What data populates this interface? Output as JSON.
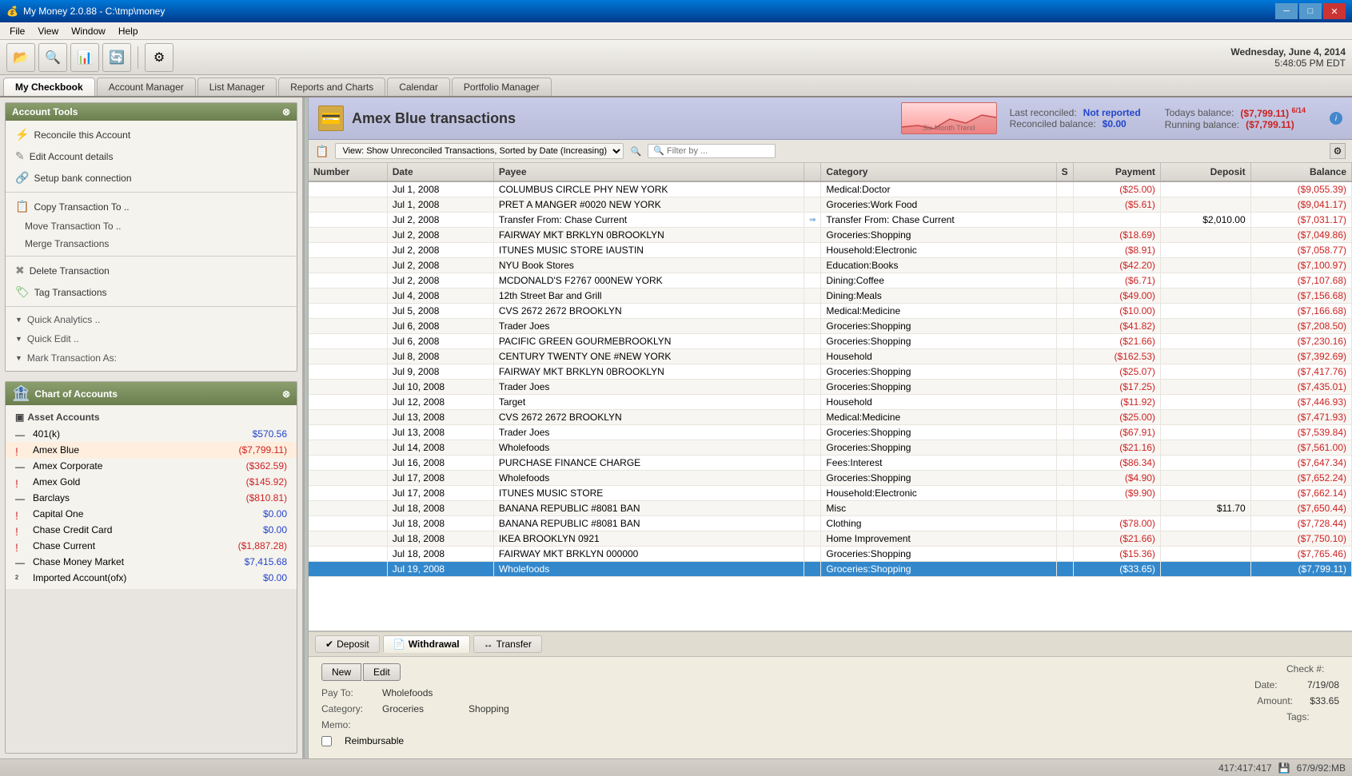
{
  "titleBar": {
    "title": "My Money 2.0.88 - C:\\tmp\\money",
    "icon": "💰",
    "buttons": [
      "minimize",
      "maximize",
      "close"
    ]
  },
  "menuBar": {
    "items": [
      "File",
      "View",
      "Window",
      "Help"
    ]
  },
  "toolbar": {
    "buttons": [
      "folder-open",
      "search",
      "chart",
      "sync",
      "settings"
    ]
  },
  "tabs": [
    {
      "label": "My Checkbook",
      "active": true
    },
    {
      "label": "Account Manager",
      "active": false
    },
    {
      "label": "List Manager",
      "active": false
    },
    {
      "label": "Reports and Charts",
      "active": false
    },
    {
      "label": "Calendar",
      "active": false
    },
    {
      "label": "Portfolio Manager",
      "active": false
    }
  ],
  "accountHeader": {
    "icon": "💳",
    "title": "Amex Blue transactions",
    "lastReconciled": "Not reported",
    "todaysBalance": "($7,799.11)",
    "reconciledBalance": "$0.00",
    "runningBalance": "($7,799.11)",
    "date": "6/14",
    "chartLabel": "Six Month Trend"
  },
  "filterBar": {
    "viewText": "View: Show Unreconciled Transactions, Sorted by Date (Increasing)",
    "filterPlaceholder": "🔍 Filter by ..."
  },
  "tableHeaders": [
    "Number",
    "Date",
    "Payee",
    "",
    "Category",
    "S",
    "Payment",
    "Deposit",
    "Balance"
  ],
  "transactions": [
    {
      "num": "",
      "date": "Jul 1, 2008",
      "payee": "COLUMBUS CIRCLE PHY NEW YORK",
      "arrow": "",
      "category": "Medical:Doctor",
      "s": "",
      "payment": "($25.00)",
      "deposit": "",
      "balance": "($9,055.39)",
      "alt": false
    },
    {
      "num": "",
      "date": "Jul 1, 2008",
      "payee": "PRET A MANGER #0020 NEW YORK",
      "arrow": "",
      "category": "Groceries:Work Food",
      "s": "",
      "payment": "($5.61)",
      "deposit": "",
      "balance": "($9,041.17)",
      "alt": true
    },
    {
      "num": "",
      "date": "Jul 2, 2008",
      "payee": "Transfer From: Chase Current",
      "arrow": "⇒",
      "category": "Transfer From: Chase Current",
      "s": "",
      "payment": "",
      "deposit": "$2,010.00",
      "balance": "($7,031.17)",
      "alt": false
    },
    {
      "num": "",
      "date": "Jul 2, 2008",
      "payee": "FAIRWAY MKT BRKLYN 0BROOKLYN",
      "arrow": "",
      "category": "Groceries:Shopping",
      "s": "",
      "payment": "($18.69)",
      "deposit": "",
      "balance": "($7,049.86)",
      "alt": true
    },
    {
      "num": "",
      "date": "Jul 2, 2008",
      "payee": "ITUNES MUSIC STORE IAUSTIN",
      "arrow": "",
      "category": "Household:Electronic",
      "s": "",
      "payment": "($8.91)",
      "deposit": "",
      "balance": "($7,058.77)",
      "alt": false
    },
    {
      "num": "",
      "date": "Jul 2, 2008",
      "payee": "NYU Book Stores",
      "arrow": "",
      "category": "Education:Books",
      "s": "",
      "payment": "($42.20)",
      "deposit": "",
      "balance": "($7,100.97)",
      "alt": true
    },
    {
      "num": "",
      "date": "Jul 2, 2008",
      "payee": "MCDONALD'S F2767 000NEW YORK",
      "arrow": "",
      "category": "Dining:Coffee",
      "s": "",
      "payment": "($6.71)",
      "deposit": "",
      "balance": "($7,107.68)",
      "alt": false
    },
    {
      "num": "",
      "date": "Jul 4, 2008",
      "payee": "12th Street Bar and Grill",
      "arrow": "",
      "category": "Dining:Meals",
      "s": "",
      "payment": "($49.00)",
      "deposit": "",
      "balance": "($7,156.68)",
      "alt": true
    },
    {
      "num": "",
      "date": "Jul 5, 2008",
      "payee": "CVS 2672 2672    BROOKLYN",
      "arrow": "",
      "category": "Medical:Medicine",
      "s": "",
      "payment": "($10.00)",
      "deposit": "",
      "balance": "($7,166.68)",
      "alt": false
    },
    {
      "num": "",
      "date": "Jul 6, 2008",
      "payee": "Trader Joes",
      "arrow": "",
      "category": "Groceries:Shopping",
      "s": "",
      "payment": "($41.82)",
      "deposit": "",
      "balance": "($7,208.50)",
      "alt": true
    },
    {
      "num": "",
      "date": "Jul 6, 2008",
      "payee": "PACIFIC GREEN GOURMEBROOKLYN",
      "arrow": "",
      "category": "Groceries:Shopping",
      "s": "",
      "payment": "($21.66)",
      "deposit": "",
      "balance": "($7,230.16)",
      "alt": false
    },
    {
      "num": "",
      "date": "Jul 8, 2008",
      "payee": "CENTURY TWENTY ONE #NEW YORK",
      "arrow": "",
      "category": "Household",
      "s": "",
      "payment": "($162.53)",
      "deposit": "",
      "balance": "($7,392.69)",
      "alt": true
    },
    {
      "num": "",
      "date": "Jul 9, 2008",
      "payee": "FAIRWAY MKT BRKLYN 0BROOKLYN",
      "arrow": "",
      "category": "Groceries:Shopping",
      "s": "",
      "payment": "($25.07)",
      "deposit": "",
      "balance": "($7,417.76)",
      "alt": false
    },
    {
      "num": "",
      "date": "Jul 10, 2008",
      "payee": "Trader Joes",
      "arrow": "",
      "category": "Groceries:Shopping",
      "s": "",
      "payment": "($17.25)",
      "deposit": "",
      "balance": "($7,435.01)",
      "alt": true
    },
    {
      "num": "",
      "date": "Jul 12, 2008",
      "payee": "Target",
      "arrow": "",
      "category": "Household",
      "s": "",
      "payment": "($11.92)",
      "deposit": "",
      "balance": "($7,446.93)",
      "alt": false
    },
    {
      "num": "",
      "date": "Jul 13, 2008",
      "payee": "CVS 2672 2672    BROOKLYN",
      "arrow": "",
      "category": "Medical:Medicine",
      "s": "",
      "payment": "($25.00)",
      "deposit": "",
      "balance": "($7,471.93)",
      "alt": true
    },
    {
      "num": "",
      "date": "Jul 13, 2008",
      "payee": "Trader Joes",
      "arrow": "",
      "category": "Groceries:Shopping",
      "s": "",
      "payment": "($67.91)",
      "deposit": "",
      "balance": "($7,539.84)",
      "alt": false
    },
    {
      "num": "",
      "date": "Jul 14, 2008",
      "payee": "Wholefoods",
      "arrow": "",
      "category": "Groceries:Shopping",
      "s": "",
      "payment": "($21.16)",
      "deposit": "",
      "balance": "($7,561.00)",
      "alt": true
    },
    {
      "num": "",
      "date": "Jul 16, 2008",
      "payee": "PURCHASE FINANCE CHARGE",
      "arrow": "",
      "category": "Fees:Interest",
      "s": "",
      "payment": "($86.34)",
      "deposit": "",
      "balance": "($7,647.34)",
      "alt": false
    },
    {
      "num": "",
      "date": "Jul 17, 2008",
      "payee": "Wholefoods",
      "arrow": "",
      "category": "Groceries:Shopping",
      "s": "",
      "payment": "($4.90)",
      "deposit": "",
      "balance": "($7,652.24)",
      "alt": true
    },
    {
      "num": "",
      "date": "Jul 17, 2008",
      "payee": "ITUNES MUSIC STORE",
      "arrow": "",
      "category": "Household:Electronic",
      "s": "",
      "payment": "($9.90)",
      "deposit": "",
      "balance": "($7,662.14)",
      "alt": false
    },
    {
      "num": "",
      "date": "Jul 18, 2008",
      "payee": "BANANA REPUBLIC #8081 BAN",
      "arrow": "",
      "category": "Misc",
      "s": "",
      "payment": "",
      "deposit": "$11.70",
      "balance": "($7,650.44)",
      "alt": true
    },
    {
      "num": "",
      "date": "Jul 18, 2008",
      "payee": "BANANA REPUBLIC #8081 BAN",
      "arrow": "",
      "category": "Clothing",
      "s": "",
      "payment": "($78.00)",
      "deposit": "",
      "balance": "($7,728.44)",
      "alt": false
    },
    {
      "num": "",
      "date": "Jul 18, 2008",
      "payee": "IKEA BROOKLYN 0921",
      "arrow": "",
      "category": "Home Improvement",
      "s": "",
      "payment": "($21.66)",
      "deposit": "",
      "balance": "($7,750.10)",
      "alt": true
    },
    {
      "num": "",
      "date": "Jul 18, 2008",
      "payee": "FAIRWAY MKT BRKLYN 000000",
      "arrow": "",
      "category": "Groceries:Shopping",
      "s": "",
      "payment": "($15.36)",
      "deposit": "",
      "balance": "($7,765.46)",
      "alt": false
    },
    {
      "num": "",
      "date": "Jul 19, 2008",
      "payee": "Wholefoods",
      "arrow": "",
      "category": "Groceries:Shopping",
      "s": "",
      "payment": "($33.65)",
      "deposit": "",
      "balance": "($7,799.11)",
      "selected": true,
      "alt": true
    }
  ],
  "sidebar": {
    "accountTools": {
      "title": "Account Tools",
      "items": [
        {
          "label": "Reconcile this Account",
          "icon": "⚡"
        },
        {
          "label": "Edit Account details",
          "icon": "✎"
        },
        {
          "label": "Setup bank connection",
          "icon": "🔗"
        },
        {
          "label": "Copy Transaction To ..",
          "icon": "📋"
        },
        {
          "label": "Move Transaction To ..",
          "icon": "→",
          "sub": true
        },
        {
          "label": "Merge Transactions",
          "icon": "⊕",
          "sub": true
        },
        {
          "label": "Delete Transaction",
          "icon": "✖"
        },
        {
          "label": "Tag Transactions",
          "icon": "🏷"
        },
        {
          "label": "Quick Analytics ..",
          "expandable": true
        },
        {
          "label": "Quick Edit ..",
          "expandable": true
        },
        {
          "label": "Mark Transaction As:",
          "expandable": true
        }
      ]
    },
    "chartOfAccounts": {
      "title": "Chart of Accounts",
      "sections": [
        {
          "name": "Asset Accounts",
          "items": [
            {
              "name": "401(k)",
              "balance": "$570.56",
              "positive": true,
              "icon": "—"
            },
            {
              "name": "Amex Blue",
              "balance": "($7,799.11)",
              "positive": false,
              "selected": true,
              "icon": "!"
            },
            {
              "name": "Amex Corporate",
              "balance": "($362.59)",
              "positive": false,
              "icon": "—"
            },
            {
              "name": "Amex Gold",
              "balance": "($145.92)",
              "positive": false,
              "icon": "!"
            },
            {
              "name": "Barclays",
              "balance": "($810.81)",
              "positive": false,
              "icon": "—"
            },
            {
              "name": "Capital One",
              "balance": "$0.00",
              "positive": true,
              "icon": "!"
            },
            {
              "name": "Chase Credit Card",
              "balance": "$0.00",
              "positive": true,
              "icon": "!"
            },
            {
              "name": "Chase Current",
              "balance": "($1,887.28)",
              "positive": false,
              "icon": "!"
            },
            {
              "name": "Chase Money Market",
              "balance": "$7,415.68",
              "positive": true,
              "icon": "—"
            },
            {
              "name": "Imported Account(ofx)",
              "balance": "$0.00",
              "positive": true,
              "icon": "²"
            }
          ]
        }
      ]
    }
  },
  "bottomForm": {
    "tabs": [
      {
        "label": "Deposit",
        "icon": "⬇",
        "active": false
      },
      {
        "label": "Withdrawal",
        "icon": "⬆",
        "active": true
      },
      {
        "label": "Transfer",
        "icon": "↔",
        "active": false
      }
    ],
    "buttons": {
      "new": "New",
      "edit": "Edit"
    },
    "fields": {
      "payTo": "Wholefoods",
      "category": "Groceries",
      "category2": "Shopping",
      "memo": "",
      "reimbursable": false,
      "checkNum": "",
      "date": "7/19/08",
      "amount": "$33.65",
      "tags": ""
    }
  },
  "statusBar": {
    "coords": "417:417:417",
    "icon1": "💾",
    "size": "67/9/92:MB"
  },
  "dateTime": {
    "day": "Wednesday, June 4, 2014",
    "time": "5:48:05 PM EDT"
  }
}
